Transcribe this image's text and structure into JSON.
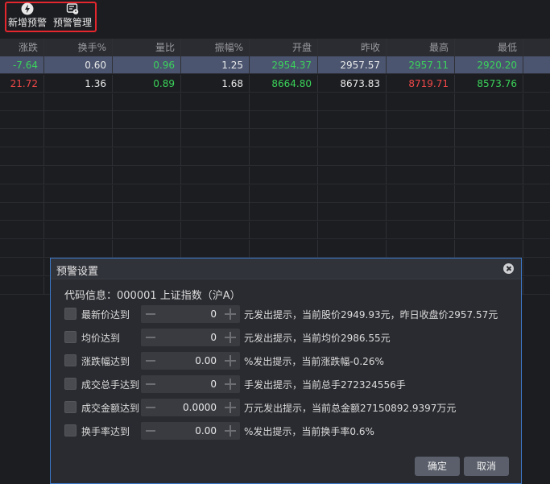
{
  "toolbar": {
    "add_alert": {
      "label": "新增预警",
      "icon": "lightning-icon"
    },
    "manage_alert": {
      "label": "预警管理",
      "icon": "alert-manage-icon"
    }
  },
  "table": {
    "headers": [
      "涨跌",
      "换手%",
      "量比",
      "振幅%",
      "开盘",
      "昨收",
      "最高",
      "最低"
    ],
    "rows": [
      {
        "selected": true,
        "cells": [
          {
            "v": "-7.64",
            "c": "green"
          },
          {
            "v": "0.60",
            "c": "white"
          },
          {
            "v": "0.96",
            "c": "green"
          },
          {
            "v": "1.25",
            "c": "white"
          },
          {
            "v": "2954.37",
            "c": "green"
          },
          {
            "v": "2957.57",
            "c": "white"
          },
          {
            "v": "2957.11",
            "c": "green"
          },
          {
            "v": "2920.20",
            "c": "green"
          }
        ]
      },
      {
        "selected": false,
        "cells": [
          {
            "v": "21.72",
            "c": "red"
          },
          {
            "v": "1.36",
            "c": "white"
          },
          {
            "v": "0.89",
            "c": "green"
          },
          {
            "v": "1.68",
            "c": "white"
          },
          {
            "v": "8664.80",
            "c": "green"
          },
          {
            "v": "8673.83",
            "c": "white"
          },
          {
            "v": "8719.71",
            "c": "red"
          },
          {
            "v": "8573.76",
            "c": "green"
          }
        ]
      }
    ]
  },
  "dialog": {
    "title": "预警设置",
    "code_info": "代码信息：000001  上证指数（沪A）",
    "options": [
      {
        "label": "最新价达到",
        "value": "0",
        "hint": "元发出提示，当前股价2949.93元，昨日收盘价2957.57元"
      },
      {
        "label": "均价达到",
        "value": "0",
        "hint": "元发出提示，当前均价2986.55元"
      },
      {
        "label": "涨跌幅达到",
        "value": "0.00",
        "hint": "%发出提示，当前涨跌幅-0.26%"
      },
      {
        "label": "成交总手达到",
        "value": "0",
        "hint": "手发出提示，当前总手272324556手"
      },
      {
        "label": "成交金额达到",
        "value": "0.0000",
        "hint": "万元发出提示，当前总金额27150892.9397万元"
      },
      {
        "label": "换手率达到",
        "value": "0.00",
        "hint": "%发出提示，当前换手率0.6%"
      }
    ],
    "confirm_label": "确定",
    "cancel_label": "取消"
  },
  "colors": {
    "red": "#f04848",
    "green": "#3bd35a",
    "highlight_border": "#e4262d",
    "dialog_border": "#3b79c9"
  }
}
